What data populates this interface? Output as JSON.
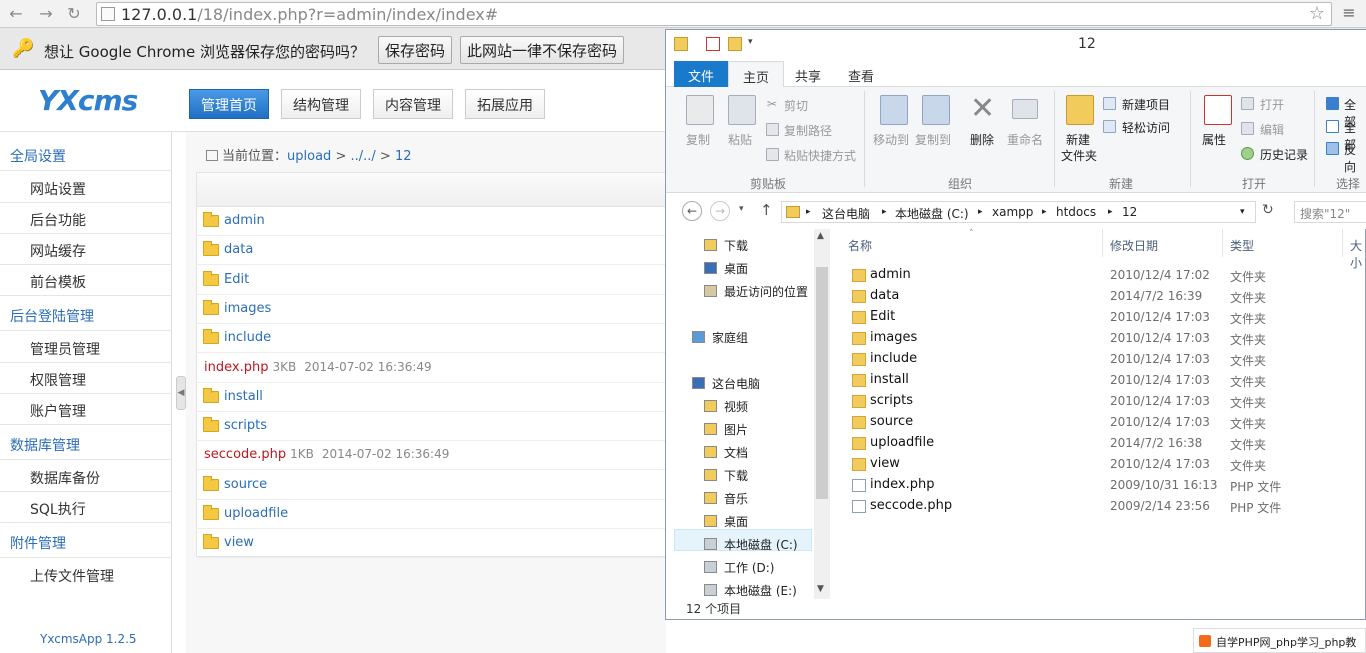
{
  "browser": {
    "url_host": "127.0.0.1",
    "url_path": "/18/index.php?r=admin/index/index#",
    "back_icon": "back-arrow-icon",
    "forward_icon": "forward-arrow-icon",
    "reload_icon": "reload-icon"
  },
  "password_bar": {
    "message": "想让 Google Chrome 浏览器保存您的密码吗？",
    "save_label": "保存密码",
    "never_label": "此网站一律不保存密码"
  },
  "admin": {
    "logo": "YXcms",
    "top_nav": [
      "管理首页",
      "结构管理",
      "内容管理",
      "拓展应用"
    ],
    "breadcrumb": {
      "prefix": "当前位置：",
      "parts": [
        "upload",
        "../../",
        "12"
      ],
      "sep": ">"
    },
    "sidebar": {
      "groups": [
        {
          "label": "全局设置",
          "items": [
            "网站设置",
            "后台功能",
            "网站缓存",
            "前台模板"
          ]
        },
        {
          "label": "后台登陆管理",
          "items": [
            "管理员管理",
            "权限管理",
            "账户管理"
          ]
        },
        {
          "label": "数据库管理",
          "items": [
            "数据库备份",
            "SQL执行"
          ]
        },
        {
          "label": "附件管理",
          "items": [
            "上传文件管理"
          ]
        }
      ],
      "version": "YxcmsApp 1.2.5"
    },
    "files": [
      {
        "name": "admin",
        "kind": "folder"
      },
      {
        "name": "data",
        "kind": "folder"
      },
      {
        "name": "Edit",
        "kind": "folder"
      },
      {
        "name": "images",
        "kind": "folder"
      },
      {
        "name": "include",
        "kind": "folder"
      },
      {
        "name": "index.php",
        "kind": "php",
        "size": "3KB",
        "date": "2014-07-02 16:36:49"
      },
      {
        "name": "install",
        "kind": "folder"
      },
      {
        "name": "scripts",
        "kind": "folder"
      },
      {
        "name": "seccode.php",
        "kind": "php",
        "size": "1KB",
        "date": "2014-07-02 16:36:49"
      },
      {
        "name": "source",
        "kind": "folder"
      },
      {
        "name": "uploadfile",
        "kind": "folder"
      },
      {
        "name": "view",
        "kind": "folder"
      }
    ]
  },
  "explorer": {
    "title": "12",
    "tabs": {
      "file": "文件",
      "home": "主页",
      "share": "共享",
      "view": "查看"
    },
    "ribbon": {
      "copy": "复制",
      "paste": "粘贴",
      "cut": "剪切",
      "copy_path": "复制路径",
      "paste_shortcut": "粘贴快捷方式",
      "clipboard": "剪贴板",
      "move_to": "移动到",
      "copy_to": "复制到",
      "delete": "删除",
      "rename": "重命名",
      "organize": "组织",
      "new_folder_l1": "新建",
      "new_folder_l2": "文件夹",
      "new_item": "新建项目",
      "easy_access": "轻松访问",
      "new": "新建",
      "properties": "属性",
      "open": "打开",
      "edit": "编辑",
      "history": "历史记录",
      "open_group": "打开",
      "select_all": "全部",
      "select_none": "全部",
      "invert": "反向",
      "select": "选择"
    },
    "address": {
      "parts": [
        "这台电脑",
        "本地磁盘 (C:)",
        "xampp",
        "htdocs",
        "12"
      ],
      "search_placeholder": "搜索\"12\""
    },
    "nav": {
      "top_items": [
        "下载",
        "桌面",
        "最近访问的位置"
      ],
      "homegroup": "家庭组",
      "this_pc": "这台电脑",
      "pc_items": [
        "视频",
        "图片",
        "文档",
        "下载",
        "音乐",
        "桌面",
        "本地磁盘 (C:)",
        "工作 (D:)",
        "本地磁盘 (E:)"
      ]
    },
    "columns": {
      "name": "名称",
      "date": "修改日期",
      "type": "类型",
      "size": "大小"
    },
    "files": [
      {
        "name": "admin",
        "date": "2010/12/4 17:02",
        "type": "文件夹",
        "kind": "folder"
      },
      {
        "name": "data",
        "date": "2014/7/2 16:39",
        "type": "文件夹",
        "kind": "folder"
      },
      {
        "name": "Edit",
        "date": "2010/12/4 17:03",
        "type": "文件夹",
        "kind": "folder"
      },
      {
        "name": "images",
        "date": "2010/12/4 17:03",
        "type": "文件夹",
        "kind": "folder"
      },
      {
        "name": "include",
        "date": "2010/12/4 17:03",
        "type": "文件夹",
        "kind": "folder"
      },
      {
        "name": "install",
        "date": "2010/12/4 17:03",
        "type": "文件夹",
        "kind": "folder"
      },
      {
        "name": "scripts",
        "date": "2010/12/4 17:03",
        "type": "文件夹",
        "kind": "folder"
      },
      {
        "name": "source",
        "date": "2010/12/4 17:03",
        "type": "文件夹",
        "kind": "folder"
      },
      {
        "name": "uploadfile",
        "date": "2014/7/2 16:38",
        "type": "文件夹",
        "kind": "folder"
      },
      {
        "name": "view",
        "date": "2010/12/4 17:03",
        "type": "文件夹",
        "kind": "folder"
      },
      {
        "name": "index.php",
        "date": "2009/10/31 16:13",
        "type": "PHP 文件",
        "kind": "php"
      },
      {
        "name": "seccode.php",
        "date": "2009/2/14 23:56",
        "type": "PHP 文件",
        "kind": "php"
      }
    ],
    "status": "12 个项目"
  },
  "watermark": "自学PHP网_php学习_php教"
}
